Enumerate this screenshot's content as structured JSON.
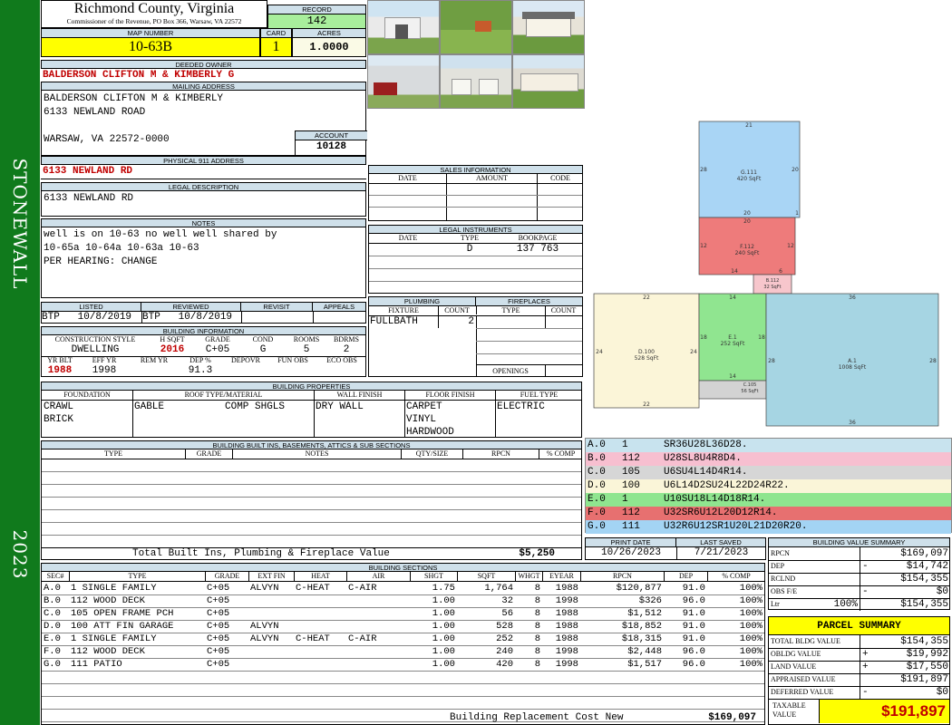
{
  "sidebar": {
    "district": "STONEWALL",
    "year": "2023"
  },
  "header": {
    "county": "Richmond County, Virginia",
    "commissioner": "Commissioner of the Revenue, PO Box 366, Warsaw, VA 22572"
  },
  "record": {
    "label": "RECORD",
    "value": "142"
  },
  "map": {
    "label": "MAP NUMBER",
    "value": "10-63B",
    "card_label": "CARD",
    "card": "1",
    "acres_label": "ACRES",
    "acres": "1.0000"
  },
  "owner": {
    "deeded_label": "DEEDED OWNER",
    "deeded": "BALDERSON CLIFTON M & KIMBERLY G",
    "mailing_label": "MAILING ADDRESS",
    "mail1": "BALDERSON CLIFTON M & KIMBERLY",
    "mail2": "6133 NEWLAND ROAD",
    "mail3": "WARSAW, VA 22572-0000",
    "account_label": "ACCOUNT",
    "account": "10128"
  },
  "physical": {
    "label": "PHYSICAL 911 ADDRESS",
    "value": "6133 NEWLAND RD"
  },
  "legal": {
    "label": "LEGAL DESCRIPTION",
    "value": "6133 NEWLAND RD"
  },
  "notes": {
    "label": "NOTES",
    "line1": "well is on 10-63 no well well shared by",
    "line2": "10-65a 10-64a 10-63a 10-63",
    "line3": "PER HEARING: CHANGE"
  },
  "sales": {
    "label": "SALES INFORMATION",
    "cols": [
      "DATE",
      "AMOUNT",
      "CODE"
    ]
  },
  "instruments": {
    "label": "LEGAL INSTRUMENTS",
    "cols": [
      "DATE",
      "TYPE",
      "BOOKPAGE"
    ],
    "type": "D",
    "bookpage": "137 763"
  },
  "listing": {
    "listed_label": "LISTED",
    "reviewed_label": "REVIEWED",
    "revisit_label": "REVISIT",
    "appeals_label": "APPEALS",
    "listed": "BTP   10/8/2019",
    "reviewed": "BTP   10/8/2019"
  },
  "plumbing": {
    "label": "PLUMBING",
    "fixture_label": "FIXTURE",
    "count_label": "COUNT",
    "fixture": "FULLBATH",
    "count": "2"
  },
  "fireplaces": {
    "label": "FIREPLACES",
    "type_label": "TYPE",
    "count_label": "COUNT",
    "openings_label": "OPENINGS"
  },
  "building": {
    "label": "BUILDING INFORMATION",
    "cols1": [
      "CONSTRUCTION STYLE",
      "H SQFT",
      "GRADE",
      "COND",
      "ROOMS",
      "BDRMS"
    ],
    "style": "DWELLING",
    "hsqft": "2016",
    "grade": "C+05",
    "cond": "G",
    "rooms": "5",
    "bdrms": "2",
    "cols2": [
      "YR BLT",
      "EFF YR",
      "REM YR",
      "DEP %",
      "DEPOVR",
      "FUN OBS",
      "ECO OBS"
    ],
    "yrblt": "1988",
    "effyr": "1998",
    "dep": "91.3"
  },
  "properties": {
    "label": "BUILDING PROPERTIES",
    "cols": [
      "FOUNDATION",
      "ROOF TYPE/MATERIAL",
      "WALL FINISH",
      "FLOOR FINISH",
      "FUEL TYPE"
    ],
    "foundation1": "CRAWL",
    "foundation2": "BRICK",
    "roof_type": "GABLE",
    "roof_mat": "COMP SHGLS",
    "wall": "DRY WALL",
    "floor1": "CARPET",
    "floor2": "VINYL",
    "floor3": "HARDWOOD",
    "fuel": "ELECTRIC"
  },
  "builtins": {
    "label": "BUILDING BUILT INS, BASEMENTS, ATTICS & SUB SECTIONS",
    "cols": [
      "TYPE",
      "GRADE",
      "NOTES",
      "QTY/SIZE",
      "RPCN",
      "% COMP"
    ],
    "total_label": "Total Built Ins, Plumbing & Fireplace Value",
    "total": "$5,250"
  },
  "dates": {
    "print_label": "PRINT DATE",
    "print": "10/26/2023",
    "saved_label": "LAST SAVED",
    "saved": "7/21/2023"
  },
  "sections": {
    "label": "BUILDING SECTIONS",
    "cols": [
      "SEC#",
      "TYPE",
      "GRADE",
      "EXT FIN",
      "HEAT",
      "AIR",
      "SHGT",
      "SQFT",
      "WHGT",
      "EYEAR",
      "RPCN",
      "DEP",
      "% COMP"
    ],
    "rows": [
      [
        "A.0",
        "1 SINGLE FAMILY",
        "C+05",
        "ALVYN",
        "C-HEAT",
        "C-AIR",
        "1.75",
        "1,764",
        "8",
        "1988",
        "$120,877",
        "91.0",
        "100%"
      ],
      [
        "B.0",
        "112 WOOD DECK",
        "C+05",
        "",
        "",
        "",
        "1.00",
        "32",
        "8",
        "1998",
        "$326",
        "96.0",
        "100%"
      ],
      [
        "C.0",
        "105 OPEN FRAME PCH",
        "C+05",
        "",
        "",
        "",
        "1.00",
        "56",
        "8",
        "1988",
        "$1,512",
        "91.0",
        "100%"
      ],
      [
        "D.0",
        "100 ATT FIN GARAGE",
        "C+05",
        "ALVYN",
        "",
        "",
        "1.00",
        "528",
        "8",
        "1988",
        "$18,852",
        "91.0",
        "100%"
      ],
      [
        "E.0",
        "1 SINGLE FAMILY",
        "C+05",
        "ALVYN",
        "C-HEAT",
        "C-AIR",
        "1.00",
        "252",
        "8",
        "1988",
        "$18,315",
        "91.0",
        "100%"
      ],
      [
        "F.0",
        "112 WOOD DECK",
        "C+05",
        "",
        "",
        "",
        "1.00",
        "240",
        "8",
        "1998",
        "$2,448",
        "96.0",
        "100%"
      ],
      [
        "G.0",
        "111 PATIO",
        "C+05",
        "",
        "",
        "",
        "1.00",
        "420",
        "8",
        "1998",
        "$1,517",
        "96.0",
        "100%"
      ]
    ],
    "replacement_label": "Building Replacement Cost New",
    "replacement": "$169,097"
  },
  "sketch": {
    "areas": [
      {
        "id": "G.111",
        "sqft": "420 SqFt",
        "color": "#a9d5f5"
      },
      {
        "id": "F.112",
        "sqft": "240 SqFt",
        "color": "#ee7b7b"
      },
      {
        "id": "B.112",
        "sqft": "32 SqFt",
        "color": "#f7c6cc"
      },
      {
        "id": "D.100",
        "sqft": "528 SqFt",
        "color": "#fbf5d8"
      },
      {
        "id": "E.1",
        "sqft": "252 SqFt",
        "color": "#90e590"
      },
      {
        "id": "C.105",
        "sqft": "56 SqFt",
        "color": "#d3d3d3"
      },
      {
        "id": "A.1",
        "sqft": "1008 SqFt",
        "color": "#a6d5e3"
      }
    ],
    "dims": {
      "g_top": "21",
      "g_left": "28",
      "g_right": "20",
      "g_bot_mid": "20",
      "g_bot_right": "1",
      "f_top": "20",
      "f_left": "12",
      "f_right": "12",
      "f_bot": "14",
      "f_bot_right": "6",
      "d_top": "22",
      "d_left": "24",
      "d_right": "24",
      "d_bot": "22",
      "e_top": "14",
      "e_left": "18",
      "e_right": "18",
      "e_bot": "14",
      "a_top": "36",
      "a_left": "28",
      "a_right": "28",
      "a_bot": "36"
    }
  },
  "legend": [
    {
      "sec": "A.0",
      "code": "1",
      "path": "SR36U28L36D28.",
      "color": "#c8e3ee"
    },
    {
      "sec": "B.0",
      "code": "112",
      "path": "U28SL8U4R8D4.",
      "color": "#f7bfd0"
    },
    {
      "sec": "C.0",
      "code": "105",
      "path": "U6SU4L14D4R14.",
      "color": "#d6d6d6"
    },
    {
      "sec": "D.0",
      "code": "100",
      "path": "U6L14D2SU24L22D24R22.",
      "color": "#faf5d8"
    },
    {
      "sec": "E.0",
      "code": "1",
      "path": "U10SU18L14D18R14.",
      "color": "#8fe58f"
    },
    {
      "sec": "F.0",
      "code": "112",
      "path": "U32SR6U12L20D12R14.",
      "color": "#e77070"
    },
    {
      "sec": "G.0",
      "code": "111",
      "path": "U32R6U12SR1U20L21D20R20.",
      "color": "#a3d4f4"
    }
  ],
  "value_summary": {
    "label": "BUILDING VALUE SUMMARY",
    "rpcn_label": "RPCN",
    "rpcn": "$169,097",
    "dep_label": "DEP",
    "dep_sign": "-",
    "dep": "$14,742",
    "rclnd_label": "RCLND",
    "rclnd": "$154,355",
    "obs_label": "OBS F/E",
    "obs_sign": "-",
    "obs": "$0",
    "ltr_label": "Ltr",
    "ltr_pct": "100%",
    "ltr": "$154,355"
  },
  "parcel": {
    "label": "PARCEL SUMMARY",
    "total_bldg_label": "TOTAL BLDG VALUE",
    "total_bldg": "$154,355",
    "obldg_label": "OBLDG VALUE",
    "obldg_sign": "+",
    "obldg": "$19,992",
    "land_label": "LAND VALUE",
    "land_sign": "+",
    "land": "$17,550",
    "appraised_label": "APPRAISED VALUE",
    "appraised": "$191,897",
    "deferred_label": "DEFERRED VALUE",
    "deferred_sign": "-",
    "deferred": "$0",
    "taxable_label1": "TAXABLE",
    "taxable_label2": "VALUE",
    "taxable": "$191,897"
  },
  "colors": {
    "sidebar": "#107a1c",
    "header_bg": "#cfe0ea",
    "record_bg": "#a8ee9c",
    "map_bg": "#ffff00",
    "red": "#c00000"
  }
}
